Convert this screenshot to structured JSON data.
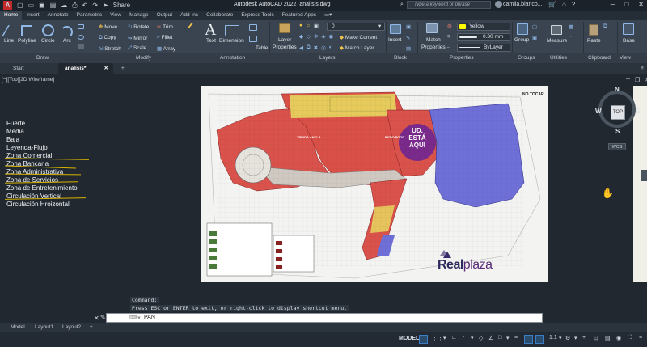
{
  "app": {
    "title": "Autodesk AutoCAD 2022",
    "filename": "analisis.dwg",
    "share_label": "Share",
    "search_placeholder": "Type a keyword or phrase",
    "user": "camila.blanco...",
    "logo_letter": "A"
  },
  "ribbon_tabs": [
    "Home",
    "Insert",
    "Annotate",
    "Parametric",
    "View",
    "Manage",
    "Output",
    "Add-ins",
    "Collaborate",
    "Express Tools",
    "Featured Apps"
  ],
  "ribbon": {
    "draw": {
      "line": "Line",
      "polyline": "Polyline",
      "circle": "Circle",
      "arc": "Arc",
      "label": "Draw"
    },
    "modify": {
      "move": "Move",
      "rotate": "Rotate",
      "trim": "Trim",
      "copy": "Copy",
      "mirror": "Mirror",
      "fillet": "Fillet",
      "stretch": "Stretch",
      "scale": "Scale",
      "array": "Array",
      "label": "Modify"
    },
    "annotation": {
      "text": "Text",
      "dimension": "Dimension",
      "table": "Table",
      "label": "Annotation"
    },
    "layers": {
      "properties_line1": "Layer",
      "properties_line2": "Properties",
      "current_layer": "0",
      "make_current": "Make Current",
      "match_layer": "Match Layer",
      "label": "Layers"
    },
    "block": {
      "insert": "Insert",
      "label": "Block"
    },
    "properties": {
      "match_line1": "Match",
      "match_line2": "Properties",
      "color": "Yellow",
      "lineweight": "0.30 mm",
      "linetype": "ByLayer",
      "label": "Properties"
    },
    "groups": {
      "group": "Group",
      "label": "Groups"
    },
    "utilities": {
      "measure": "Measure",
      "label": "Utilities"
    },
    "clipboard": {
      "paste": "Paste",
      "label": "Clipboard"
    },
    "view": {
      "base": "Base",
      "label": "View"
    }
  },
  "file_tabs": {
    "start": "Start",
    "active": "analisis*",
    "add": "+"
  },
  "viewport": {
    "label": "[−][Top][2D Wireframe]",
    "legend": [
      "Fuerte",
      "Media",
      "Baja",
      "Leyenda-Flujo",
      "Zona Comercial",
      "Zona Bancaria",
      "Zona Administrativa",
      "Zona de Servicios",
      "Zona de Entretenimiento",
      "Circulación Vertical",
      "Circulación Hroizontal"
    ]
  },
  "drawing": {
    "corner_note": "NO TOCAR",
    "marker_lines": [
      "UD.",
      "ESTÁ",
      "AQUÍ"
    ],
    "brand_prefix": "Real",
    "brand_suffix": "plaza",
    "room_label_1": "TIENDA ANCLA",
    "room_label_2": "PATIO FOOD"
  },
  "viewcube": {
    "top": "TOP",
    "north": "N",
    "south": "S",
    "west": "W",
    "east": "E",
    "wcs": "WCS"
  },
  "command": {
    "history_1": "Command:",
    "history_2": "Press ESC or ENTER to exit, or right-click to display shortcut menu.",
    "current": "PAN"
  },
  "layout_tabs": [
    "Model",
    "Layout1",
    "Layout2"
  ],
  "layout_add": "+",
  "statusbar": {
    "model": "MODEL",
    "scale": "1:1"
  },
  "colors": {
    "zone_red": "#d9534c",
    "zone_blue": "#6f6fd8",
    "zone_yellow": "#e8e060",
    "zone_purple": "#7a2a8a",
    "legend_strike": "#d8b300"
  }
}
